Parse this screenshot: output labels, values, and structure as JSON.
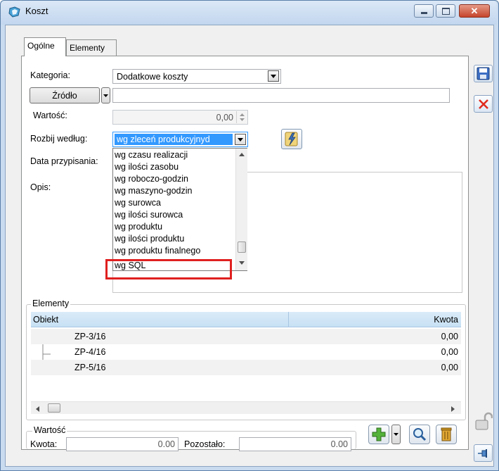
{
  "window": {
    "title": "Koszt",
    "minimize": "–",
    "maximize": "□",
    "close": "✕"
  },
  "tabs": [
    {
      "label": "Ogólne",
      "active": true
    },
    {
      "label": "Elementy",
      "active": false
    }
  ],
  "form": {
    "kategoria_label": "Kategoria:",
    "kategoria_value": "Dodatkowe koszty",
    "zrodlo_button": "Źródło",
    "zrodlo_value": "",
    "wartosc_label": "Wartość:",
    "wartosc_value": "0,00",
    "rozbij_label": "Rozbij według:",
    "rozbij_value": "wg zleceń produkcyjnyd",
    "data_label": "Data przypisania:",
    "opis_label": "Opis:"
  },
  "dropdown": {
    "items": [
      "wg czasu realizacji",
      "wg ilości zasobu",
      "wg roboczo-godzin",
      "wg maszyno-godzin",
      "wg surowca",
      "wg ilości surowca",
      "wg produktu",
      "wg ilości produktu",
      "wg produktu finalnego",
      "wg SQL"
    ],
    "highlighted": "wg SQL"
  },
  "elements": {
    "group_label": "Elementy",
    "columns": [
      "Obiekt",
      "Kwota"
    ],
    "rows": [
      {
        "obiekt": "ZP-3/16",
        "kwota": "0,00"
      },
      {
        "obiekt": "ZP-4/16",
        "kwota": "0,00"
      },
      {
        "obiekt": "ZP-5/16",
        "kwota": "0,00"
      }
    ]
  },
  "summary": {
    "group_label": "Wartość",
    "kwota_label": "Kwota:",
    "kwota_value": "0.00",
    "pozostalo_label": "Pozostało:",
    "pozostalo_value": "0.00"
  },
  "colors": {
    "highlight_border": "#e02020",
    "accent": "#3399ff",
    "grid_header": "#c7e1f4"
  }
}
